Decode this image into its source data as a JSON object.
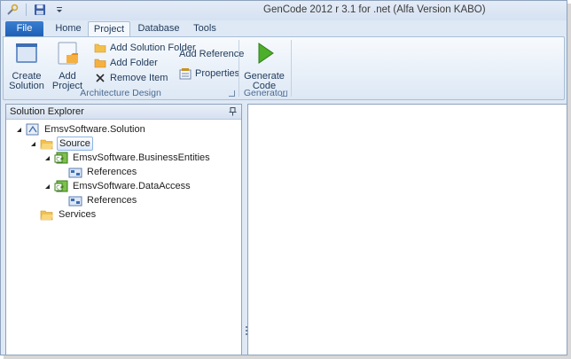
{
  "window": {
    "title": "GenCode 2012 r 3.1 for .net  (Alfa Version KABO)"
  },
  "quick_access": {
    "icons": [
      "tools-icon",
      "save-icon",
      "dropdown-arrow-icon"
    ]
  },
  "tabs": {
    "file": "File",
    "items": [
      {
        "label": "Home",
        "active": false
      },
      {
        "label": "Project",
        "active": true
      },
      {
        "label": "Database",
        "active": false
      },
      {
        "label": "Tools",
        "active": false
      }
    ]
  },
  "ribbon": {
    "architecture_group": {
      "label": "Architecture Design",
      "create_solution": "Create Solution",
      "create_solution_line1": "Create",
      "create_solution_line2": "Solution",
      "add_project": "Add Project",
      "add_solution_folder": "Add Solution Folder",
      "add_folder": "Add Folder",
      "remove_item": "Remove Item",
      "add_reference": "Add Reference",
      "properties": "Properties"
    },
    "generator_group": {
      "label": "Generator",
      "generate_code_line1": "Generate",
      "generate_code_line2": "Code"
    }
  },
  "solution_explorer": {
    "title": "Solution Explorer",
    "tree": {
      "solution": "EmsvSoftware.Solution",
      "source": "Source",
      "business_entities": "EmsvSoftware.BusinessEntities",
      "be_references": "References",
      "data_access": "EmsvSoftware.DataAccess",
      "da_references": "References",
      "services": "Services"
    },
    "selected": "Source"
  },
  "colors": {
    "file_tab": "#1d5fb6",
    "accent": "#1e395b",
    "generate_green": "#4cae2a",
    "folder_yellow": "#f3c04d"
  }
}
